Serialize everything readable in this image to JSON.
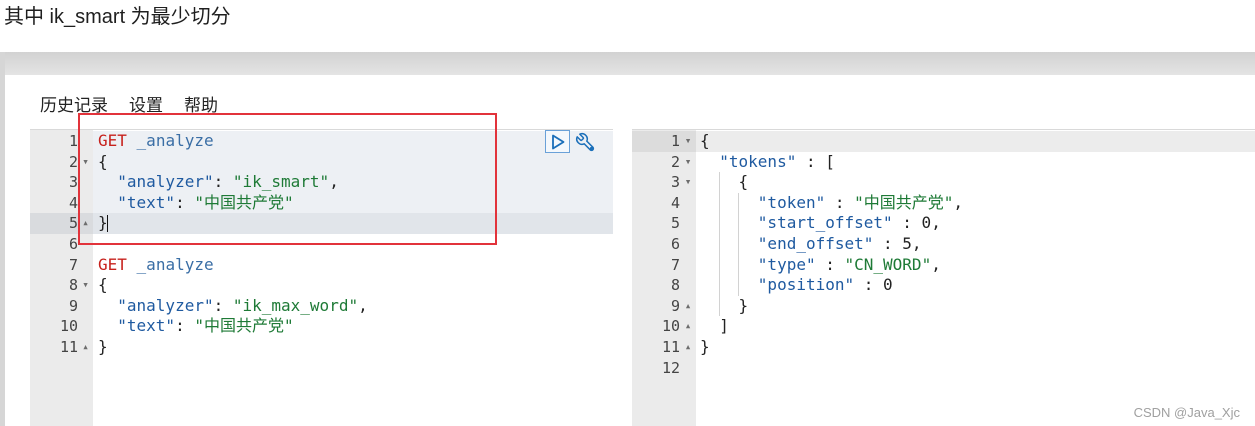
{
  "heading": "其中 ik_smart 为最少切分",
  "menu": {
    "history": "历史记录",
    "settings": "设置",
    "help": "帮助"
  },
  "toolbar": {
    "send_icon": "play-icon",
    "settings_icon": "wrench-icon",
    "accent_color": "#1b6fb9"
  },
  "annotation": {
    "box_color": "#e2333b"
  },
  "syntax_colors": {
    "method": "#c7211c",
    "path": "#3a6ea5",
    "key": "#1f5aa0",
    "string": "#1e7a36",
    "plain": "#222222"
  },
  "request_editor": {
    "lines": [
      {
        "n": 1,
        "tokens": [
          {
            "t": "GET",
            "color": "#c7211c"
          },
          {
            "t": " "
          },
          {
            "t": "_analyze",
            "color": "#3a6ea5"
          }
        ]
      },
      {
        "n": 2,
        "fold_icon": "caret-down-icon",
        "tokens": [
          {
            "t": "{"
          }
        ]
      },
      {
        "n": 3,
        "tokens": [
          {
            "t": "  "
          },
          {
            "t": "\"analyzer\"",
            "color": "#1f5aa0"
          },
          {
            "t": ": "
          },
          {
            "t": "\"ik_smart\"",
            "color": "#1e7a36"
          },
          {
            "t": ","
          }
        ]
      },
      {
        "n": 4,
        "tokens": [
          {
            "t": "  "
          },
          {
            "t": "\"text\"",
            "color": "#1f5aa0"
          },
          {
            "t": ": "
          },
          {
            "t": "\"中国共产党\"",
            "color": "#1e7a36"
          }
        ]
      },
      {
        "n": 5,
        "fold_icon": "caret-up-icon",
        "tokens": [
          {
            "t": "}"
          }
        ]
      },
      {
        "n": 6,
        "tokens": []
      },
      {
        "n": 7,
        "tokens": [
          {
            "t": "GET",
            "color": "#c7211c"
          },
          {
            "t": " "
          },
          {
            "t": "_analyze",
            "color": "#3a6ea5"
          }
        ]
      },
      {
        "n": 8,
        "fold_icon": "caret-down-icon",
        "tokens": [
          {
            "t": "{"
          }
        ]
      },
      {
        "n": 9,
        "tokens": [
          {
            "t": "  "
          },
          {
            "t": "\"analyzer\"",
            "color": "#1f5aa0"
          },
          {
            "t": ": "
          },
          {
            "t": "\"ik_max_word\"",
            "color": "#1e7a36"
          },
          {
            "t": ","
          }
        ]
      },
      {
        "n": 10,
        "tokens": [
          {
            "t": "  "
          },
          {
            "t": "\"text\"",
            "color": "#1f5aa0"
          },
          {
            "t": ": "
          },
          {
            "t": "\"中国共产党\"",
            "color": "#1e7a36"
          }
        ]
      },
      {
        "n": 11,
        "fold_icon": "caret-up-icon",
        "tokens": [
          {
            "t": "}"
          }
        ]
      }
    ]
  },
  "response_editor": {
    "lines": [
      {
        "n": 1,
        "fold_icon": "caret-down-icon",
        "tokens": [
          {
            "t": "{"
          }
        ]
      },
      {
        "n": 2,
        "fold_icon": "caret-down-icon",
        "tokens": [
          {
            "t": "  "
          },
          {
            "t": "\"tokens\"",
            "color": "#1f5aa0"
          },
          {
            "t": " : ["
          }
        ]
      },
      {
        "n": 3,
        "fold_icon": "caret-down-icon",
        "tokens": [
          {
            "t": "    {"
          }
        ]
      },
      {
        "n": 4,
        "tokens": [
          {
            "t": "      "
          },
          {
            "t": "\"token\"",
            "color": "#1f5aa0"
          },
          {
            "t": " : "
          },
          {
            "t": "\"中国共产党\"",
            "color": "#1e7a36"
          },
          {
            "t": ","
          }
        ]
      },
      {
        "n": 5,
        "tokens": [
          {
            "t": "      "
          },
          {
            "t": "\"start_offset\"",
            "color": "#1f5aa0"
          },
          {
            "t": " : 0,"
          }
        ]
      },
      {
        "n": 6,
        "tokens": [
          {
            "t": "      "
          },
          {
            "t": "\"end_offset\"",
            "color": "#1f5aa0"
          },
          {
            "t": " : 5,"
          }
        ]
      },
      {
        "n": 7,
        "tokens": [
          {
            "t": "      "
          },
          {
            "t": "\"type\"",
            "color": "#1f5aa0"
          },
          {
            "t": " : "
          },
          {
            "t": "\"CN_WORD\"",
            "color": "#1e7a36"
          },
          {
            "t": ","
          }
        ]
      },
      {
        "n": 8,
        "tokens": [
          {
            "t": "      "
          },
          {
            "t": "\"position\"",
            "color": "#1f5aa0"
          },
          {
            "t": " : 0"
          }
        ]
      },
      {
        "n": 9,
        "fold_icon": "caret-up-icon",
        "tokens": [
          {
            "t": "    }"
          }
        ]
      },
      {
        "n": 10,
        "fold_icon": "caret-up-icon",
        "tokens": [
          {
            "t": "  ]"
          }
        ]
      },
      {
        "n": 11,
        "fold_icon": "caret-up-icon",
        "tokens": [
          {
            "t": "}"
          }
        ]
      },
      {
        "n": 12,
        "tokens": []
      }
    ]
  },
  "watermark": "CSDN @Java_Xjc"
}
